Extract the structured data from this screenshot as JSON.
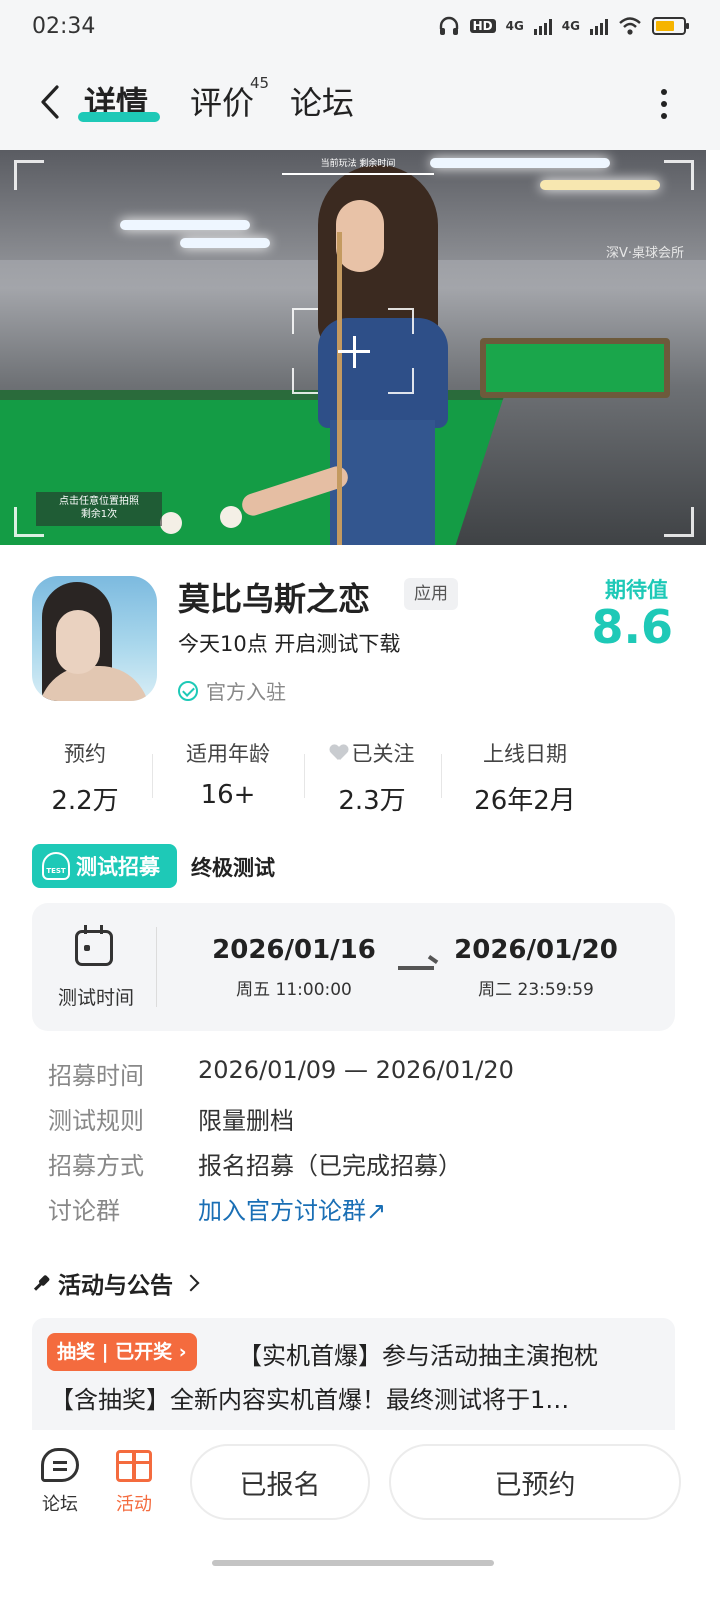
{
  "status_bar": {
    "time": "02:34",
    "hd": "HD",
    "net1": "4G",
    "net2": "4G",
    "battery_level": 0.7,
    "battery_color": "#f6b400"
  },
  "nav": {
    "tabs": [
      {
        "label": "详情"
      },
      {
        "label": "评价",
        "count": "45"
      },
      {
        "label": "论坛"
      }
    ],
    "accent": "#1ec9b7"
  },
  "banner": {
    "top_text": "当前玩法 剩余时间",
    "wall_text": "深V·桌球会所",
    "tip_line1": "点击任意位置拍照",
    "tip_line2": "剩余1次"
  },
  "app": {
    "name": "莫比乌斯之恋",
    "tag": "应用",
    "subtitle": "今天10点 开启测试下载",
    "official": "官方入驻",
    "expect_label": "期待值",
    "expect_value": "8.6"
  },
  "stats": [
    {
      "label": "预约",
      "value": "2.2万"
    },
    {
      "label": "适用年龄",
      "value": "16+"
    },
    {
      "label": "已关注",
      "value": "2.3万"
    },
    {
      "label": "上线日期",
      "value": "26年2月"
    }
  ],
  "recruit": {
    "badge": "测试招募",
    "icon_text": "TEST",
    "type": "终极测试",
    "time_label": "测试时间",
    "start_date": "2026/01/16",
    "start_time": "周五  11:00:00",
    "end_date": "2026/01/20",
    "end_time": "周二  23:59:59"
  },
  "info": [
    {
      "label": "招募时间",
      "value": "2026/01/09 — 2026/01/20"
    },
    {
      "label": "测试规则",
      "value": "限量删档"
    },
    {
      "label": "招募方式",
      "value": "报名招募（已完成招募）"
    },
    {
      "label": "讨论群",
      "value": "加入官方讨论群↗"
    }
  ],
  "activities": {
    "title": "活动与公告",
    "badge": "抽奖 | 已开奖 ›",
    "line1": "【实机首爆】参与活动抽主演抱枕",
    "line2": "【含抽奖】全新内容实机首爆！最终测试将于1…"
  },
  "bottom": {
    "forum": "论坛",
    "activity": "活动",
    "signed_btn": "已报名",
    "reserved_btn": "已预约",
    "activity_color": "#f46b3e"
  }
}
